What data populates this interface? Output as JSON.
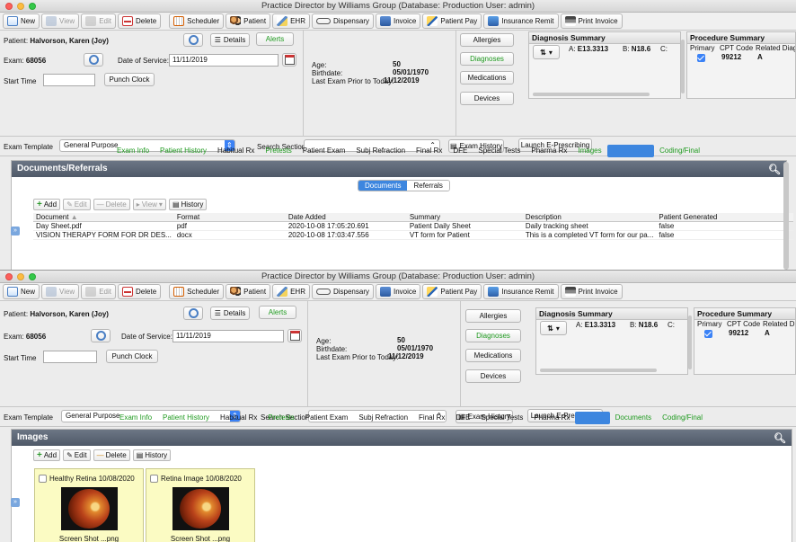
{
  "app_title": "Practice Director by Williams Group  (Database: Production  User: admin)",
  "toolbar": {
    "new": "New",
    "view": "View",
    "edit": "Edit",
    "delete": "Delete",
    "scheduler": "Scheduler",
    "patient": "Patient",
    "ehr": "EHR",
    "dispensary": "Dispensary",
    "invoice": "Invoice",
    "patient_pay": "Patient Pay",
    "insurance_remit": "Insurance Remit",
    "print_invoice": "Print Invoice"
  },
  "patient": {
    "label": "Patient:",
    "name": "Halvorson, Karen (Joy)",
    "details": "Details",
    "alerts": "Alerts",
    "exam_label": "Exam:",
    "exam_no": "68056",
    "dos_label": "Date of Service:",
    "dos": "11/11/2019",
    "start_label": "Start Time",
    "punch": "Punch Clock",
    "age_label": "Age:",
    "age": "50",
    "birth_label": "Birthdate:",
    "birth": "05/01/1970",
    "last_label": "Last Exam Prior to Today:",
    "last": "11/12/2019"
  },
  "side_buttons": {
    "allergies": "Allergies",
    "diagnoses": "Diagnoses",
    "medications": "Medications",
    "devices": "Devices"
  },
  "diagnosis": {
    "title": "Diagnosis Summary",
    "a_label": "A:",
    "a": "E13.3313",
    "b_label": "B:",
    "b": "N18.6",
    "c_label": "C:",
    "sort": "⇅"
  },
  "procedure": {
    "title": "Procedure Summary",
    "headers": [
      "Primary",
      "CPT Code",
      "Related Diagn"
    ],
    "row": {
      "code": "99212",
      "rel": "A"
    }
  },
  "template": {
    "label": "Exam Template",
    "value": "General Purpose",
    "search_label": "Search Section",
    "history": "Exam History",
    "launch": "Launch E-Prescribing"
  },
  "tabs1": [
    "Exam Info",
    "Patient History",
    "Habitual Rx",
    "Pretests",
    "Patient Exam",
    "Subj Refraction",
    "Final Rx",
    "DFE",
    "Special Tests",
    "Pharma Rx",
    "Images",
    "Documents",
    "Coding/Final"
  ],
  "tabs2": [
    "Exam Info",
    "Patient History",
    "Habitual Rx",
    "Pretests",
    "Patient Exam",
    "Subj Refraction",
    "Final Rx",
    "DFE",
    "Special Tests",
    "Pharma Rx",
    "Images",
    "Documents",
    "Coding/Final"
  ],
  "docs": {
    "title": "Documents/Referrals",
    "seg": [
      "Documents",
      "Referrals"
    ],
    "tool": {
      "add": "Add",
      "edit": "Edit",
      "delete": "Delete",
      "view": "View",
      "history": "History"
    },
    "headers": [
      "Document",
      "Format",
      "Date Added",
      "Summary",
      "Description",
      "Patient Generated"
    ],
    "rows": [
      [
        "Day Sheet.pdf",
        "pdf",
        "2020-10-08 17:05:20.691",
        "Patient Daily Sheet",
        "Daily tracking sheet",
        "false"
      ],
      [
        "VISION THERAPY FORM FOR DR DES...",
        "docx",
        "2020-10-08 17:03:47.556",
        "VT form for Patient",
        "This is a completed VT form for our pa...",
        "false"
      ]
    ]
  },
  "images": {
    "title": "Images",
    "tool": {
      "add": "Add",
      "edit": "Edit",
      "delete": "Delete",
      "history": "History"
    },
    "cards": [
      {
        "caption": "Healthy Retina 10/08/2020",
        "file": "Screen Shot ...png"
      },
      {
        "caption": "Retina Image 10/08/2020",
        "file": "Screen Shot ...png"
      }
    ]
  },
  "colors": {
    "accent": "#3d86df",
    "tab_green": "#1f9a1f",
    "card_bg": "#fbfbc3"
  }
}
